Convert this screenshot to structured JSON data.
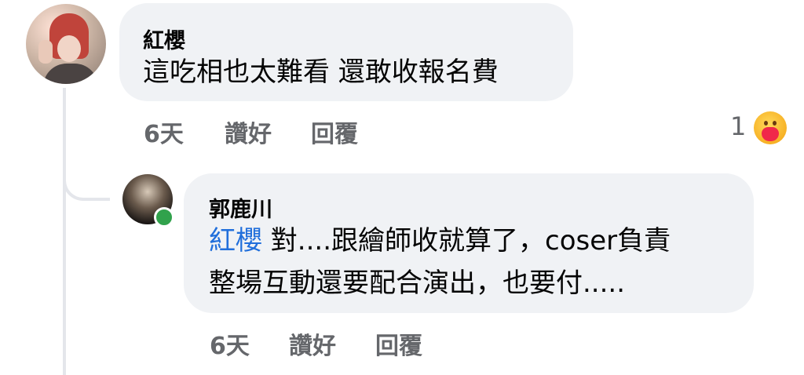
{
  "comments": [
    {
      "author": "紅櫻",
      "text": "這吃相也太難看 還敢收報名費",
      "time": "6天",
      "like_label": "讚好",
      "reply_label": "回覆",
      "reaction_count": "1",
      "reaction_icon": "care-reaction-icon"
    },
    {
      "author": "郭鹿川",
      "mention": "紅櫻",
      "line1_after_mention": " 對....跟繪師收就算了，coser負責",
      "line2": "整場互動還要配合演出，也要付.....",
      "time": "6天",
      "like_label": "讚好",
      "reply_label": "回覆",
      "online": true
    }
  ],
  "colors": {
    "bubble": "#f0f2f5",
    "meta_text": "#65676b",
    "mention": "#216fdb",
    "online": "#31a24c"
  }
}
